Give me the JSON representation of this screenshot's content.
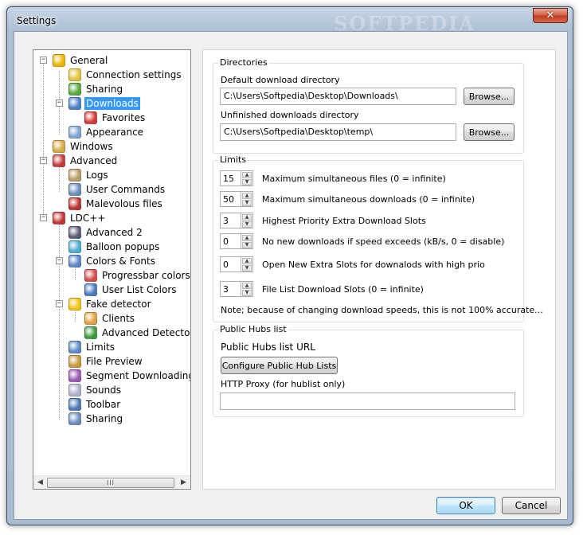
{
  "window": {
    "title": "Settings",
    "watermark": "SOFTPEDIA",
    "close_glyph": "✕"
  },
  "tree": {
    "items": [
      {
        "label": "General",
        "icon": "globe-icon",
        "color": "#f1b300"
      },
      {
        "label": "Connection settings",
        "icon": "plug-icon",
        "color": "#e4c23c"
      },
      {
        "label": "Sharing",
        "icon": "share-icon",
        "color": "#57a83d"
      },
      {
        "label": "Downloads",
        "icon": "download-icon",
        "color": "#4d7fc9"
      },
      {
        "label": "Favorites",
        "icon": "puzzle-icon",
        "color": "#d13a36"
      },
      {
        "label": "Appearance",
        "icon": "palette-icon",
        "color": "#7da4d6"
      },
      {
        "label": "Windows",
        "icon": "windows-icon",
        "color": "#d9a945"
      },
      {
        "label": "Advanced",
        "icon": "wrench-icon",
        "color": "#c43c3c"
      },
      {
        "label": "Logs",
        "icon": "log-icon",
        "color": "#b89a64"
      },
      {
        "label": "User Commands",
        "icon": "user-command-icon",
        "color": "#6d8dbd"
      },
      {
        "label": "Malevolous files",
        "icon": "bug-icon",
        "color": "#b83232"
      },
      {
        "label": "LDC++",
        "icon": "cube-icon",
        "color": "#c23434"
      },
      {
        "label": "Advanced 2",
        "icon": "gear-icon",
        "color": "#5c5c78"
      },
      {
        "label": "Balloon popups",
        "icon": "balloon-icon",
        "color": "#4aaed4"
      },
      {
        "label": "Colors & Fonts",
        "icon": "color-icon",
        "color": "#5a87c7"
      },
      {
        "label": "Progressbar colors",
        "icon": "progressbar-icon",
        "color": "#d84b4b"
      },
      {
        "label": "User List Colors",
        "icon": "checklist-icon",
        "color": "#4a7bc0"
      },
      {
        "label": "Fake detector",
        "icon": "warning-icon",
        "color": "#f1c40f"
      },
      {
        "label": "Clients",
        "icon": "client-icon",
        "color": "#e0a040"
      },
      {
        "label": "Advanced Detector Pa",
        "icon": "detector-icon",
        "color": "#3d9c3d"
      },
      {
        "label": "Limits",
        "icon": "limit-icon",
        "color": "#5b8bc4"
      },
      {
        "label": "File Preview",
        "icon": "preview-icon",
        "color": "#c99a3a"
      },
      {
        "label": "Segment Downloading",
        "icon": "segment-icon",
        "color": "#9b59b6"
      },
      {
        "label": "Sounds",
        "icon": "sound-icon",
        "color": "#b0b0d0"
      },
      {
        "label": "Toolbar",
        "icon": "toolbar-icon",
        "color": "#4f79b5"
      },
      {
        "label": "Sharing",
        "icon": "share-folder-icon",
        "color": "#6b8ec0"
      }
    ],
    "scroll_thumb": "III"
  },
  "directories": {
    "title": "Directories",
    "default_label": "Default download directory",
    "default_value": "C:\\Users\\Softpedia\\Desktop\\Downloads\\",
    "unfinished_label": "Unfinished downloads directory",
    "unfinished_value": "C:\\Users\\Softpedia\\Desktop\\temp\\",
    "browse_label": "Browse..."
  },
  "limits": {
    "title": "Limits",
    "rows": [
      {
        "value": "15",
        "label": "Maximum simultaneous files (0 = infinite)"
      },
      {
        "value": "50",
        "label": "Maximum simultaneous downloads (0 = infinite)"
      },
      {
        "value": "3",
        "label": "Highest Priority Extra Download Slots"
      },
      {
        "value": "0",
        "label": "No new downloads if speed exceeds (kB/s, 0 = disable)"
      },
      {
        "value": "0",
        "label": "Open New Extra Slots for downalods with high prio"
      },
      {
        "value": "3",
        "label": "File List Download Slots (0 = infinite)"
      }
    ],
    "note": "Note; because of changing download speeds, this is not 100% accurate..."
  },
  "hubs": {
    "title": "Public Hubs list",
    "url_label": "Public Hubs list URL",
    "configure_label": "Configure Public Hub Lists",
    "proxy_label": "HTTP Proxy (for hublist only)",
    "proxy_value": ""
  },
  "footer": {
    "ok_label": "OK",
    "cancel_label": "Cancel"
  }
}
